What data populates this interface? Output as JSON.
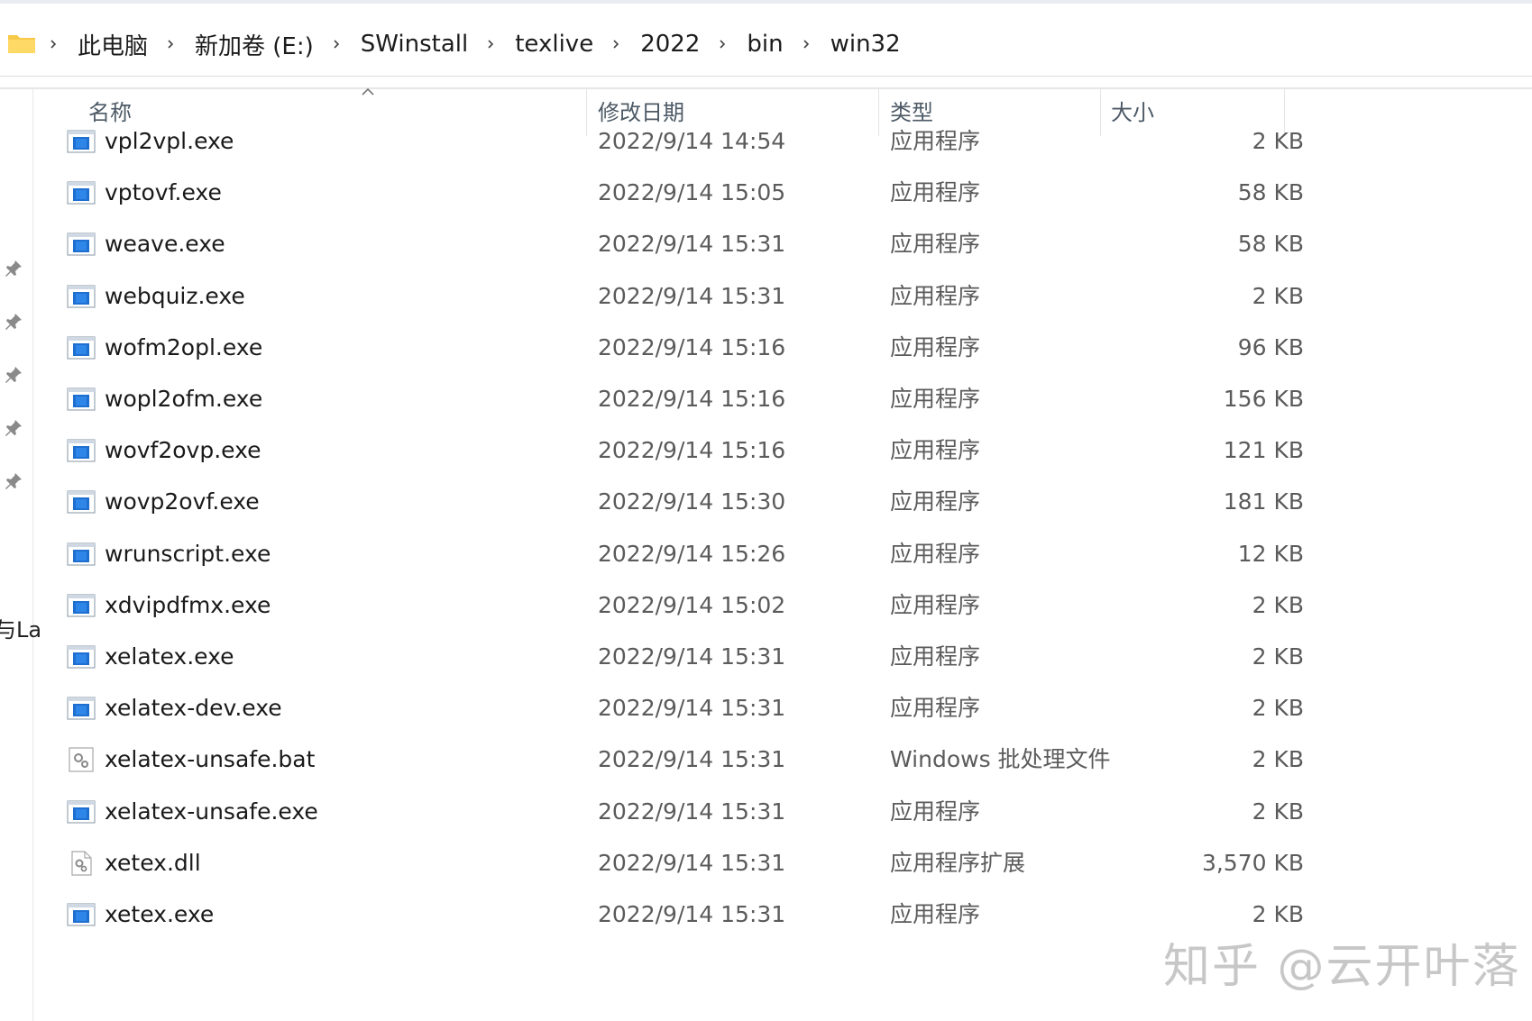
{
  "breadcrumb": [
    "此电脑",
    "新加卷 (E:)",
    "SWinstall",
    "texlive",
    "2022",
    "bin",
    "win32"
  ],
  "columns": {
    "name": "名称",
    "date": "修改日期",
    "type": "类型",
    "size": "大小"
  },
  "nav_partial_text": "与La",
  "files": [
    {
      "name": "vpl2vpl.exe",
      "date": "2022/9/14 14:54",
      "type": "应用程序",
      "size": "2 KB",
      "icon": "exe-icon"
    },
    {
      "name": "vptovf.exe",
      "date": "2022/9/14 15:05",
      "type": "应用程序",
      "size": "58 KB",
      "icon": "exe-icon"
    },
    {
      "name": "weave.exe",
      "date": "2022/9/14 15:31",
      "type": "应用程序",
      "size": "58 KB",
      "icon": "exe-icon"
    },
    {
      "name": "webquiz.exe",
      "date": "2022/9/14 15:31",
      "type": "应用程序",
      "size": "2 KB",
      "icon": "exe-icon"
    },
    {
      "name": "wofm2opl.exe",
      "date": "2022/9/14 15:16",
      "type": "应用程序",
      "size": "96 KB",
      "icon": "exe-icon"
    },
    {
      "name": "wopl2ofm.exe",
      "date": "2022/9/14 15:16",
      "type": "应用程序",
      "size": "156 KB",
      "icon": "exe-icon"
    },
    {
      "name": "wovf2ovp.exe",
      "date": "2022/9/14 15:16",
      "type": "应用程序",
      "size": "121 KB",
      "icon": "exe-icon"
    },
    {
      "name": "wovp2ovf.exe",
      "date": "2022/9/14 15:30",
      "type": "应用程序",
      "size": "181 KB",
      "icon": "exe-icon"
    },
    {
      "name": "wrunscript.exe",
      "date": "2022/9/14 15:26",
      "type": "应用程序",
      "size": "12 KB",
      "icon": "exe-icon"
    },
    {
      "name": "xdvipdfmx.exe",
      "date": "2022/9/14 15:02",
      "type": "应用程序",
      "size": "2 KB",
      "icon": "exe-icon"
    },
    {
      "name": "xelatex.exe",
      "date": "2022/9/14 15:31",
      "type": "应用程序",
      "size": "2 KB",
      "icon": "exe-icon"
    },
    {
      "name": "xelatex-dev.exe",
      "date": "2022/9/14 15:31",
      "type": "应用程序",
      "size": "2 KB",
      "icon": "exe-icon"
    },
    {
      "name": "xelatex-unsafe.bat",
      "date": "2022/9/14 15:31",
      "type": "Windows 批处理文件",
      "size": "2 KB",
      "icon": "bat-icon"
    },
    {
      "name": "xelatex-unsafe.exe",
      "date": "2022/9/14 15:31",
      "type": "应用程序",
      "size": "2 KB",
      "icon": "exe-icon"
    },
    {
      "name": "xetex.dll",
      "date": "2022/9/14 15:31",
      "type": "应用程序扩展",
      "size": "3,570 KB",
      "icon": "dll-icon"
    },
    {
      "name": "xetex.exe",
      "date": "2022/9/14 15:31",
      "type": "应用程序",
      "size": "2 KB",
      "icon": "exe-icon"
    }
  ],
  "watermark": "知乎 @云开叶落"
}
